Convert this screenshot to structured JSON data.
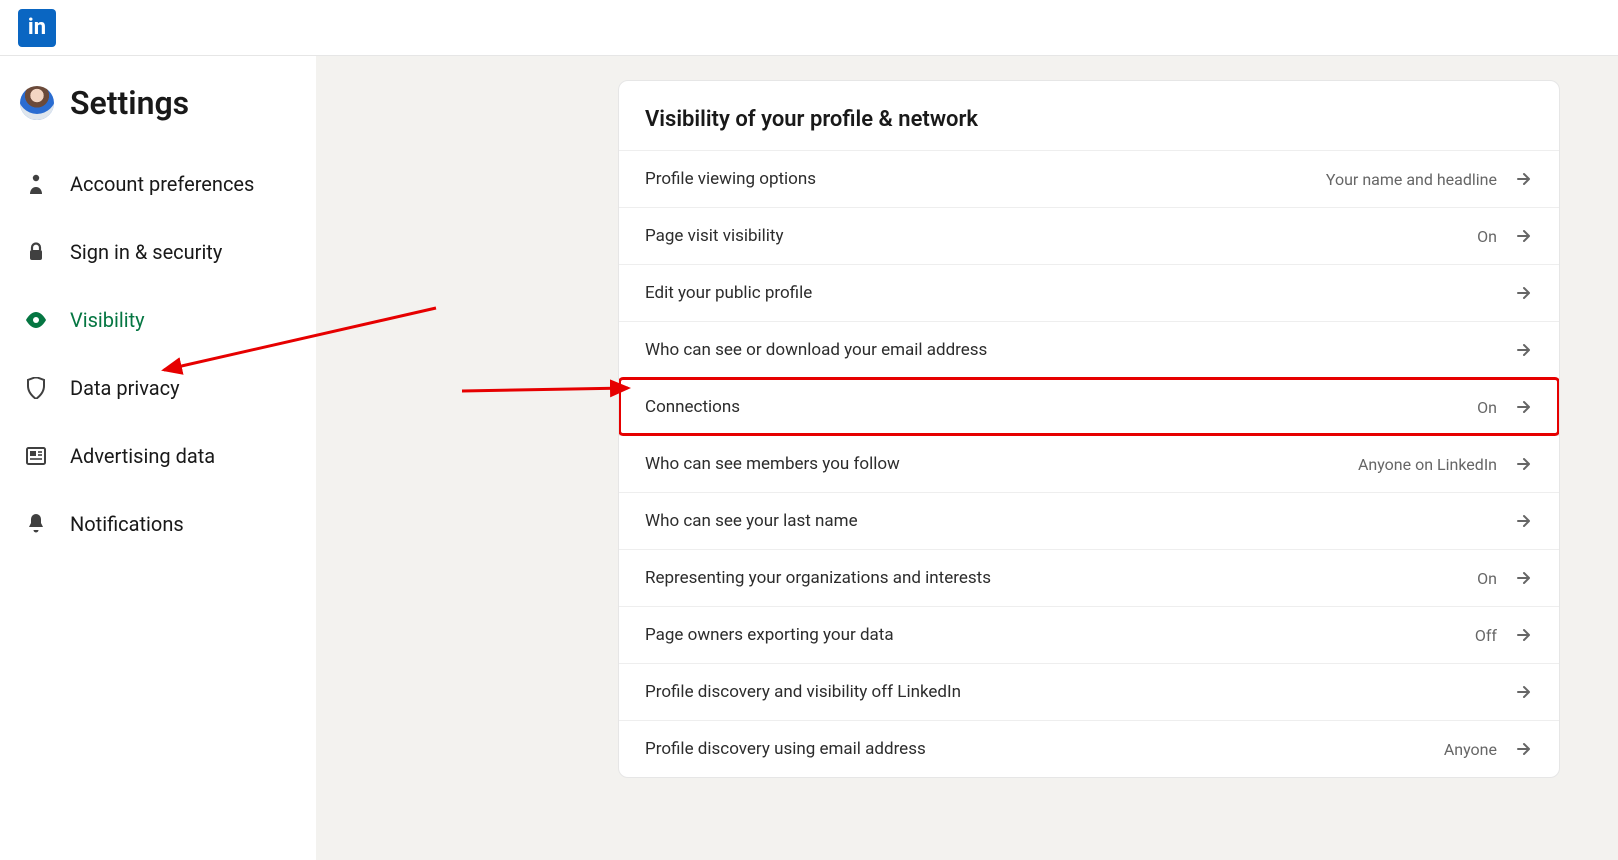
{
  "header": {
    "logo_text": "in"
  },
  "sidebar": {
    "title": "Settings",
    "items": [
      {
        "label": "Account preferences"
      },
      {
        "label": "Sign in & security"
      },
      {
        "label": "Visibility"
      },
      {
        "label": "Data privacy"
      },
      {
        "label": "Advertising data"
      },
      {
        "label": "Notifications"
      }
    ]
  },
  "panel": {
    "title": "Visibility of your profile & network",
    "rows": [
      {
        "label": "Profile viewing options",
        "value": "Your name and headline"
      },
      {
        "label": "Page visit visibility",
        "value": "On"
      },
      {
        "label": "Edit your public profile",
        "value": ""
      },
      {
        "label": "Who can see or download your email address",
        "value": ""
      },
      {
        "label": "Connections",
        "value": "On"
      },
      {
        "label": "Who can see members you follow",
        "value": "Anyone on LinkedIn"
      },
      {
        "label": "Who can see your last name",
        "value": ""
      },
      {
        "label": "Representing your organizations and interests",
        "value": "On"
      },
      {
        "label": "Page owners exporting your data",
        "value": "Off"
      },
      {
        "label": "Profile discovery and visibility off LinkedIn",
        "value": ""
      },
      {
        "label": "Profile discovery using email address",
        "value": "Anyone"
      }
    ]
  },
  "annotations": {
    "highlight_row_index": 4
  }
}
